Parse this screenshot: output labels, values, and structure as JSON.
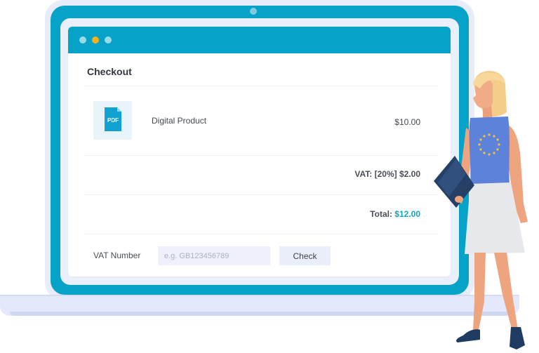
{
  "checkout": {
    "title": "Checkout",
    "product": {
      "icon": "pdf-file-icon",
      "icon_text": "PDF",
      "name": "Digital Product",
      "price": "$10.00"
    },
    "vat_line": "VAT: [20%] $2.00",
    "total": {
      "label": "Total:",
      "amount": "$12.00"
    },
    "vat_number": {
      "label": "VAT Number",
      "placeholder": "e.g. GB123456789",
      "value": ""
    },
    "check_button_label": "Check"
  },
  "colors": {
    "brand": "#06a2c8",
    "accent_dot": "#f5b21a",
    "total_amount": "#10a3c3"
  }
}
